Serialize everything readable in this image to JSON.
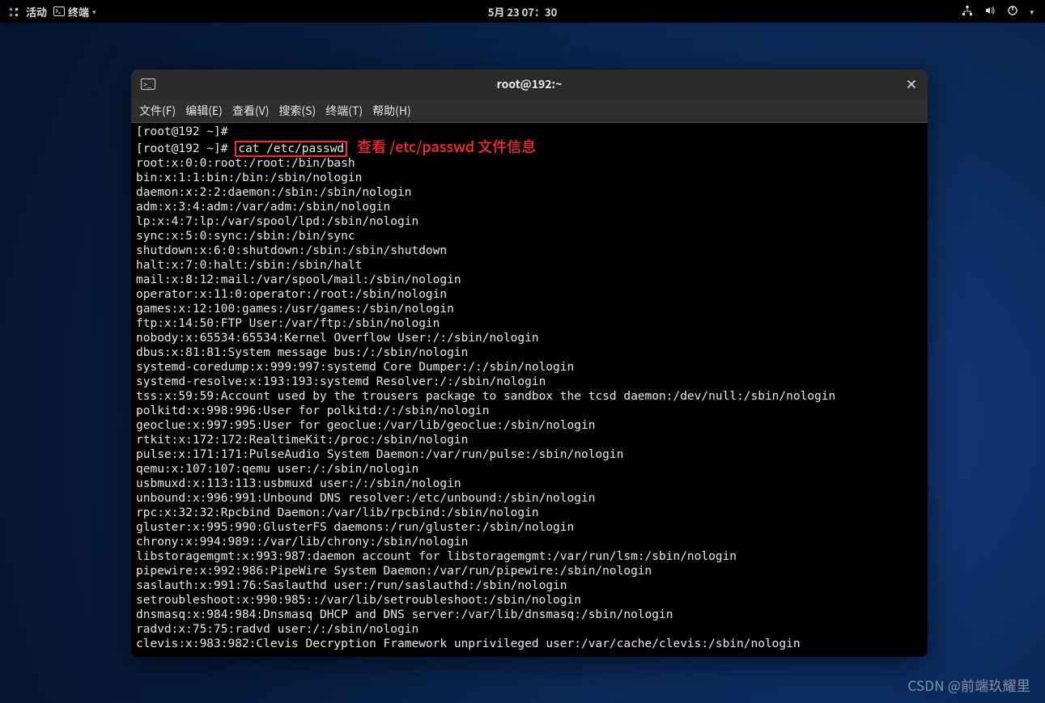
{
  "topbar": {
    "activities": "活动",
    "app_label": "终端",
    "clock": "5月 23 07：30"
  },
  "window": {
    "title": "root@192:~"
  },
  "menubar": {
    "file": "文件(F)",
    "edit": "编辑(E)",
    "view": "查看(V)",
    "search": "搜索(S)",
    "terminal": "终端(T)",
    "help": "帮助(H)"
  },
  "terminal": {
    "prompt1": "[root@192 ~]#",
    "prompt2": "[root@192 ~]# ",
    "command": "cat /etc/passwd",
    "annotation": "查看 /etc/passwd 文件信息",
    "lines": [
      "root:x:0:0:root:/root:/bin/bash",
      "bin:x:1:1:bin:/bin:/sbin/nologin",
      "daemon:x:2:2:daemon:/sbin:/sbin/nologin",
      "adm:x:3:4:adm:/var/adm:/sbin/nologin",
      "lp:x:4:7:lp:/var/spool/lpd:/sbin/nologin",
      "sync:x:5:0:sync:/sbin:/bin/sync",
      "shutdown:x:6:0:shutdown:/sbin:/sbin/shutdown",
      "halt:x:7:0:halt:/sbin:/sbin/halt",
      "mail:x:8:12:mail:/var/spool/mail:/sbin/nologin",
      "operator:x:11:0:operator:/root:/sbin/nologin",
      "games:x:12:100:games:/usr/games:/sbin/nologin",
      "ftp:x:14:50:FTP User:/var/ftp:/sbin/nologin",
      "nobody:x:65534:65534:Kernel Overflow User:/:/sbin/nologin",
      "dbus:x:81:81:System message bus:/:/sbin/nologin",
      "systemd-coredump:x:999:997:systemd Core Dumper:/:/sbin/nologin",
      "systemd-resolve:x:193:193:systemd Resolver:/:/sbin/nologin",
      "tss:x:59:59:Account used by the trousers package to sandbox the tcsd daemon:/dev/null:/sbin/nologin",
      "polkitd:x:998:996:User for polkitd:/:/sbin/nologin",
      "geoclue:x:997:995:User for geoclue:/var/lib/geoclue:/sbin/nologin",
      "rtkit:x:172:172:RealtimeKit:/proc:/sbin/nologin",
      "pulse:x:171:171:PulseAudio System Daemon:/var/run/pulse:/sbin/nologin",
      "qemu:x:107:107:qemu user:/:/sbin/nologin",
      "usbmuxd:x:113:113:usbmuxd user:/:/sbin/nologin",
      "unbound:x:996:991:Unbound DNS resolver:/etc/unbound:/sbin/nologin",
      "rpc:x:32:32:Rpcbind Daemon:/var/lib/rpcbind:/sbin/nologin",
      "gluster:x:995:990:GlusterFS daemons:/run/gluster:/sbin/nologin",
      "chrony:x:994:989::/var/lib/chrony:/sbin/nologin",
      "libstoragemgmt:x:993:987:daemon account for libstoragemgmt:/var/run/lsm:/sbin/nologin",
      "pipewire:x:992:986:PipeWire System Daemon:/var/run/pipewire:/sbin/nologin",
      "saslauth:x:991:76:Saslauthd user:/run/saslauthd:/sbin/nologin",
      "setroubleshoot:x:990:985::/var/lib/setroubleshoot:/sbin/nologin",
      "dnsmasq:x:984:984:Dnsmasq DHCP and DNS server:/var/lib/dnsmasq:/sbin/nologin",
      "radvd:x:75:75:radvd user:/:/sbin/nologin",
      "clevis:x:983:982:Clevis Decryption Framework unprivileged user:/var/cache/clevis:/sbin/nologin"
    ]
  },
  "watermark": "CSDN @前端玖耀里"
}
